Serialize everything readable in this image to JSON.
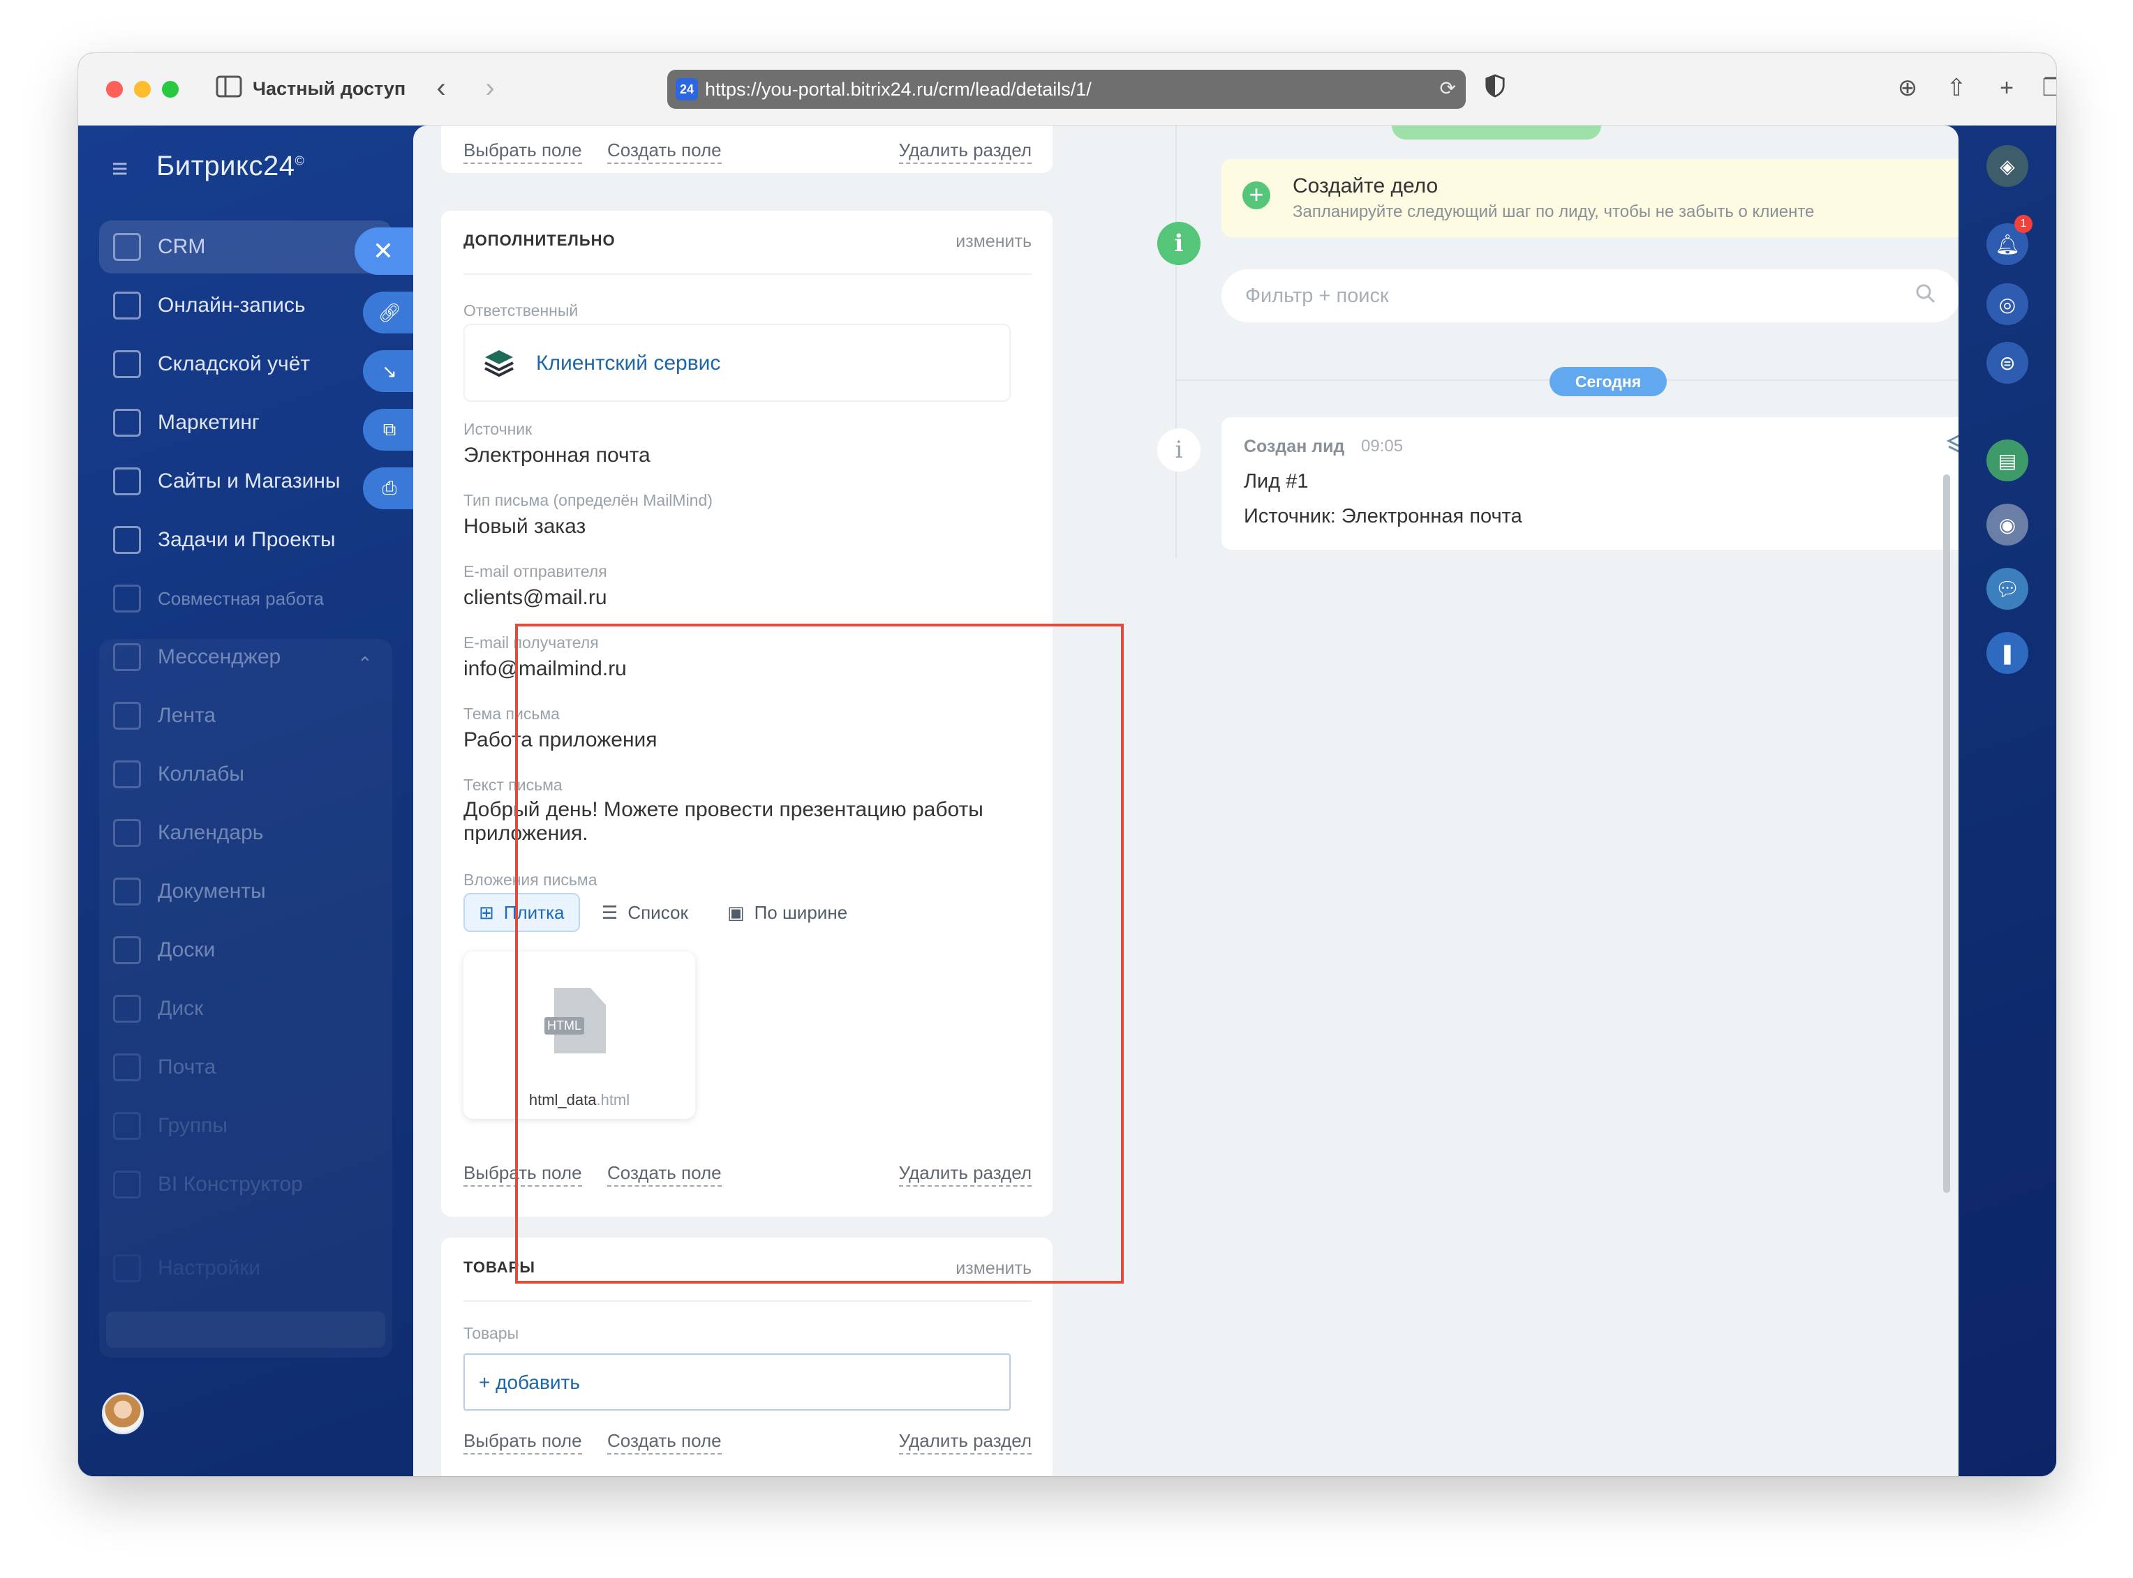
{
  "browser": {
    "private_label": "Частный доступ",
    "favicon_text": "24",
    "url": "https://you-portal.bitrix24.ru/crm/lead/details/1/",
    "icons": [
      "sidebar-icon",
      "back-icon",
      "forward-icon",
      "translate-icon",
      "reload-icon",
      "shield-icon",
      "download-icon",
      "share-icon",
      "new-tab-icon",
      "tabs-overview-icon"
    ]
  },
  "app": {
    "brand": "Битрикс24",
    "brand_mark": "©",
    "menu": [
      {
        "label": "CRM",
        "icon": "funnel-icon"
      },
      {
        "label": "Онлайн-запись",
        "icon": "calendar-check-icon"
      },
      {
        "label": "Складской учёт",
        "icon": "warehouse-icon"
      },
      {
        "label": "Маркетинг",
        "icon": "target-icon"
      },
      {
        "label": "Сайты и Магазины",
        "icon": "cart-icon"
      },
      {
        "label": "Задачи и Проекты",
        "icon": "checkbox-icon"
      },
      {
        "label": "Совместная работа",
        "icon": "collaboration-icon"
      },
      {
        "label": "Мессенджер",
        "icon": "chat-icon"
      },
      {
        "label": "Лента",
        "icon": "feed-icon"
      },
      {
        "label": "Коллабы",
        "icon": "collab-icon"
      },
      {
        "label": "Календарь",
        "icon": "calendar-icon"
      },
      {
        "label": "Документы",
        "icon": "document-icon"
      },
      {
        "label": "Доски",
        "icon": "board-icon"
      },
      {
        "label": "Диск",
        "icon": "disk-icon"
      },
      {
        "label": "Почта",
        "icon": "mail-icon"
      },
      {
        "label": "Группы",
        "icon": "groups-icon"
      },
      {
        "label": "BI Конструктор",
        "icon": "bi-icon"
      },
      {
        "label": "Настройки",
        "icon": "gear-icon"
      }
    ]
  },
  "details": {
    "top_actions": {
      "select_field": "Выбрать поле",
      "create_field": "Создать поле",
      "delete_section": "Удалить раздел"
    },
    "additional": {
      "title": "ДОПОЛНИТЕЛЬНО",
      "edit": "изменить",
      "responsible_label": "Ответственный",
      "responsible_name": "Клиентский сервис",
      "source_label": "Источник",
      "source_value": "Электронная почта",
      "mail_type_label": "Тип письма (определён MailMind)",
      "mail_type_value": "Новый заказ",
      "sender_label": "E-mail отправителя",
      "sender_value": "clients@mail.ru",
      "recipient_label": "E-mail получателя",
      "recipient_value": "info@mailmind.ru",
      "subject_label": "Тема письма",
      "subject_value": "Работа приложения",
      "body_label": "Текст письма",
      "body_value": "Добрый день! Можете провести презентацию работы приложения.",
      "attachments_label": "Вложения письма",
      "view_tiles": "Плитка",
      "view_list": "Список",
      "view_width": "По ширине",
      "file_tag": "HTML",
      "file_base": "html_data",
      "file_ext": ".html",
      "actions": {
        "select_field": "Выбрать поле",
        "create_field": "Создать поле",
        "delete_section": "Удалить раздел"
      }
    },
    "products": {
      "title": "ТОВАРЫ",
      "edit": "изменить",
      "products_label": "Товары",
      "add": "+ добавить",
      "actions": {
        "select_field": "Выбрать поле",
        "create_field": "Создать поле",
        "delete_section": "Удалить раздел"
      }
    }
  },
  "timeline": {
    "deal_title": "Создайте дело",
    "deal_sub": "Запланируйте следующий шаг по лиду, чтобы не забыть о клиенте",
    "search_placeholder": "Фильтр + поиск",
    "today": "Сегодня",
    "event_title": "Создан лид",
    "event_time": "09:05",
    "event_line1": "Лид #1",
    "event_line2": "Источник: Электронная почта"
  },
  "right_sidebar": {
    "notifications_count": "1"
  },
  "colors": {
    "accent": "#1d67a8",
    "highlight": "#e24c3b",
    "success": "#55c57a",
    "today_badge": "#62a8ee"
  }
}
